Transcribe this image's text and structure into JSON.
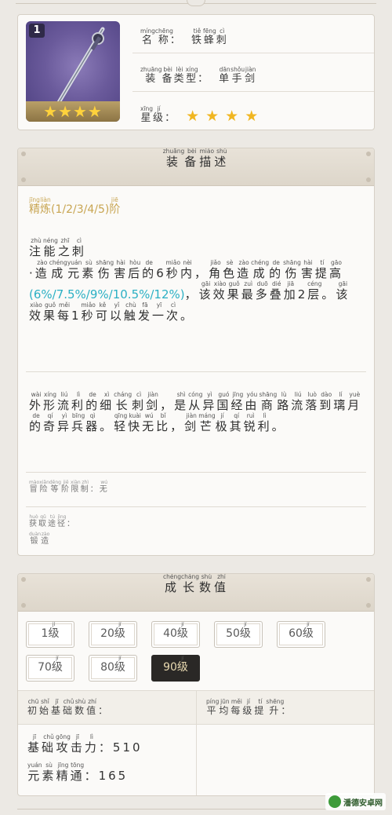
{
  "weapon": {
    "level_badge": "1",
    "portrait_stars": "★★★★",
    "name_label": [
      {
        "h": "名",
        "p": "míng"
      },
      {
        "h": "称",
        "p": "chēng"
      },
      {
        "h": "：",
        "p": ""
      }
    ],
    "name_value": [
      {
        "h": "铁",
        "p": "tiě"
      },
      {
        "h": "蜂",
        "p": "fēng"
      },
      {
        "h": "刺",
        "p": "cì"
      }
    ],
    "type_label": [
      {
        "h": "装",
        "p": "zhuāng"
      },
      {
        "h": "备",
        "p": "bèi"
      },
      {
        "h": "类",
        "p": "lèi"
      },
      {
        "h": "型",
        "p": "xíng"
      },
      {
        "h": "：",
        "p": ""
      }
    ],
    "type_value": [
      {
        "h": "单",
        "p": "dān"
      },
      {
        "h": "手",
        "p": "shǒu"
      },
      {
        "h": "剑",
        "p": "jiàn"
      }
    ],
    "rarity_label": [
      {
        "h": "星",
        "p": "xīng"
      },
      {
        "h": "级",
        "p": "jí"
      },
      {
        "h": "：",
        "p": ""
      }
    ],
    "rarity": 4,
    "star_glyph": "★"
  },
  "description": {
    "title": [
      {
        "h": "装",
        "p": "zhuāng"
      },
      {
        "h": "备",
        "p": "bèi"
      },
      {
        "h": "描",
        "p": "miáo"
      },
      {
        "h": "述",
        "p": "shù"
      }
    ],
    "refine": [
      {
        "h": "精",
        "p": "jīng"
      },
      {
        "h": "炼",
        "p": "liàn"
      },
      {
        "h": "(1/2/3/4/5)",
        "p": ""
      },
      {
        "h": "阶",
        "p": "jiē"
      }
    ],
    "passive_name": [
      {
        "h": "注",
        "p": "zhù"
      },
      {
        "h": "能",
        "p": "néng"
      },
      {
        "h": "之",
        "p": "zhī"
      },
      {
        "h": "刺",
        "p": "cì"
      }
    ],
    "passive_text_1": [
      {
        "h": "·",
        "p": ""
      },
      {
        "h": "造",
        "p": "zào"
      },
      {
        "h": "成",
        "p": "chéng"
      },
      {
        "h": "元",
        "p": "yuán"
      },
      {
        "h": "素",
        "p": "sù"
      },
      {
        "h": "伤",
        "p": "shāng"
      },
      {
        "h": "害",
        "p": "hài"
      },
      {
        "h": "后",
        "p": "hòu"
      },
      {
        "h": "的",
        "p": "de"
      },
      {
        "h": "6",
        "p": ""
      },
      {
        "h": "秒",
        "p": "miǎo"
      },
      {
        "h": "内",
        "p": "nèi"
      },
      {
        "h": "，",
        "p": ""
      },
      {
        "h": "角",
        "p": "jiǎo"
      },
      {
        "h": "色",
        "p": "sè"
      },
      {
        "h": "造",
        "p": "zào"
      },
      {
        "h": "成",
        "p": "chéng"
      },
      {
        "h": "的",
        "p": "de"
      },
      {
        "h": "伤",
        "p": "shāng"
      },
      {
        "h": "害",
        "p": "hài"
      },
      {
        "h": "提",
        "p": "tí"
      },
      {
        "h": "高",
        "p": "gāo"
      }
    ],
    "passive_highlight": "(6%/7.5%/9%/10.5%/12%)",
    "passive_text_2": [
      {
        "h": "，",
        "p": ""
      },
      {
        "h": "该",
        "p": "gāi"
      },
      {
        "h": "效",
        "p": "xiào"
      },
      {
        "h": "果",
        "p": "guǒ"
      },
      {
        "h": "最",
        "p": "zuì"
      },
      {
        "h": "多",
        "p": "duō"
      },
      {
        "h": "叠",
        "p": "dié"
      },
      {
        "h": "加",
        "p": "jiā"
      },
      {
        "h": "2",
        "p": ""
      },
      {
        "h": "层",
        "p": "céng"
      },
      {
        "h": "。",
        "p": ""
      },
      {
        "h": "该",
        "p": "gāi"
      },
      {
        "h": "效",
        "p": "xiào"
      },
      {
        "h": "果",
        "p": "guǒ"
      },
      {
        "h": "每",
        "p": "měi"
      },
      {
        "h": "1",
        "p": ""
      },
      {
        "h": "秒",
        "p": "miǎo"
      },
      {
        "h": "可",
        "p": "kě"
      },
      {
        "h": "以",
        "p": "yǐ"
      },
      {
        "h": "触",
        "p": "chù"
      },
      {
        "h": "发",
        "p": "fā"
      },
      {
        "h": "一",
        "p": "yī"
      },
      {
        "h": "次",
        "p": "cì"
      },
      {
        "h": "。",
        "p": ""
      }
    ],
    "lore": [
      {
        "h": "外",
        "p": "wài"
      },
      {
        "h": "形",
        "p": "xíng"
      },
      {
        "h": "流",
        "p": "liú"
      },
      {
        "h": "利",
        "p": "lì"
      },
      {
        "h": "的",
        "p": "de"
      },
      {
        "h": "细",
        "p": "xì"
      },
      {
        "h": "长",
        "p": "cháng"
      },
      {
        "h": "刺",
        "p": "cì"
      },
      {
        "h": "剑",
        "p": "jiàn"
      },
      {
        "h": "，",
        "p": ""
      },
      {
        "h": "是",
        "p": "shì"
      },
      {
        "h": "从",
        "p": "cóng"
      },
      {
        "h": "异",
        "p": "yì"
      },
      {
        "h": "国",
        "p": "guó"
      },
      {
        "h": "经",
        "p": "jīng"
      },
      {
        "h": "由",
        "p": "yóu"
      },
      {
        "h": "商",
        "p": "shāng"
      },
      {
        "h": "路",
        "p": "lù"
      },
      {
        "h": "流",
        "p": "liú"
      },
      {
        "h": "落",
        "p": "luò"
      },
      {
        "h": "到",
        "p": "dào"
      },
      {
        "h": "璃",
        "p": "lí"
      },
      {
        "h": "月",
        "p": "yuè"
      },
      {
        "h": "的",
        "p": "de"
      },
      {
        "h": "奇",
        "p": "qí"
      },
      {
        "h": "异",
        "p": "yì"
      },
      {
        "h": "兵",
        "p": "bīng"
      },
      {
        "h": "器",
        "p": "qì"
      },
      {
        "h": "。",
        "p": ""
      },
      {
        "h": "轻",
        "p": "qīng"
      },
      {
        "h": "快",
        "p": "kuài"
      },
      {
        "h": "无",
        "p": "wú"
      },
      {
        "h": "比",
        "p": "bǐ"
      },
      {
        "h": "，",
        "p": ""
      },
      {
        "h": "剑",
        "p": "jiàn"
      },
      {
        "h": "芒",
        "p": "máng"
      },
      {
        "h": "极",
        "p": "jí"
      },
      {
        "h": "其",
        "p": "qí"
      },
      {
        "h": "锐",
        "p": "ruì"
      },
      {
        "h": "利",
        "p": "lì"
      },
      {
        "h": "。",
        "p": ""
      }
    ],
    "rank_limit": [
      {
        "h": "冒",
        "p": "mào"
      },
      {
        "h": "险",
        "p": "xiǎn"
      },
      {
        "h": "等",
        "p": "děng"
      },
      {
        "h": "阶",
        "p": "jiē"
      },
      {
        "h": "限",
        "p": "xiàn"
      },
      {
        "h": "制",
        "p": "zhì"
      },
      {
        "h": "：",
        "p": ""
      },
      {
        "h": "无",
        "p": "wú"
      }
    ],
    "obtain_label": [
      {
        "h": "获",
        "p": "huò"
      },
      {
        "h": "取",
        "p": "qǔ"
      },
      {
        "h": "途",
        "p": "tú"
      },
      {
        "h": "径",
        "p": "jìng"
      },
      {
        "h": "：",
        "p": ""
      }
    ],
    "obtain_value": [
      {
        "h": "锻",
        "p": "duàn"
      },
      {
        "h": "造",
        "p": "zào"
      }
    ]
  },
  "growth": {
    "title": [
      {
        "h": "成",
        "p": "chéng"
      },
      {
        "h": "长",
        "p": "cháng"
      },
      {
        "h": "数",
        "p": "shù"
      },
      {
        "h": "值",
        "p": "zhí"
      }
    ],
    "level_unit": "级",
    "level_unit_pinyin": "jí",
    "levels": [
      "1",
      "20",
      "40",
      "50",
      "60",
      "70",
      "80",
      "90"
    ],
    "active_level": "90",
    "col_initial": [
      {
        "h": "初",
        "p": "chū"
      },
      {
        "h": "始",
        "p": "shǐ"
      },
      {
        "h": "基",
        "p": "jī"
      },
      {
        "h": "础",
        "p": "chǔ"
      },
      {
        "h": "数",
        "p": "shù"
      },
      {
        "h": "值",
        "p": "zhí"
      },
      {
        "h": "：",
        "p": ""
      }
    ],
    "col_avg": [
      {
        "h": "平",
        "p": "píng"
      },
      {
        "h": "均",
        "p": "jūn"
      },
      {
        "h": "每",
        "p": "měi"
      },
      {
        "h": "级",
        "p": "jí"
      },
      {
        "h": "提",
        "p": "tí"
      },
      {
        "h": "升",
        "p": "shēng"
      },
      {
        "h": "：",
        "p": ""
      }
    ],
    "atk": [
      {
        "h": "基",
        "p": "jī"
      },
      {
        "h": "础",
        "p": "chǔ"
      },
      {
        "h": "攻",
        "p": "gōng"
      },
      {
        "h": "击",
        "p": "jī"
      },
      {
        "h": "力",
        "p": "lì"
      },
      {
        "h": "：510",
        "p": ""
      }
    ],
    "em": [
      {
        "h": "元",
        "p": "yuán"
      },
      {
        "h": "素",
        "p": "sù"
      },
      {
        "h": "精",
        "p": "jīng"
      },
      {
        "h": "通",
        "p": "tōng"
      },
      {
        "h": "：165",
        "p": ""
      }
    ]
  },
  "watermark": "潘德安卓网",
  "colors": {
    "accent_cyan": "#2bb0c4",
    "star_gold": "#f0b622",
    "refine_gold": "#c8a552",
    "active_btn": "#2a2826"
  }
}
